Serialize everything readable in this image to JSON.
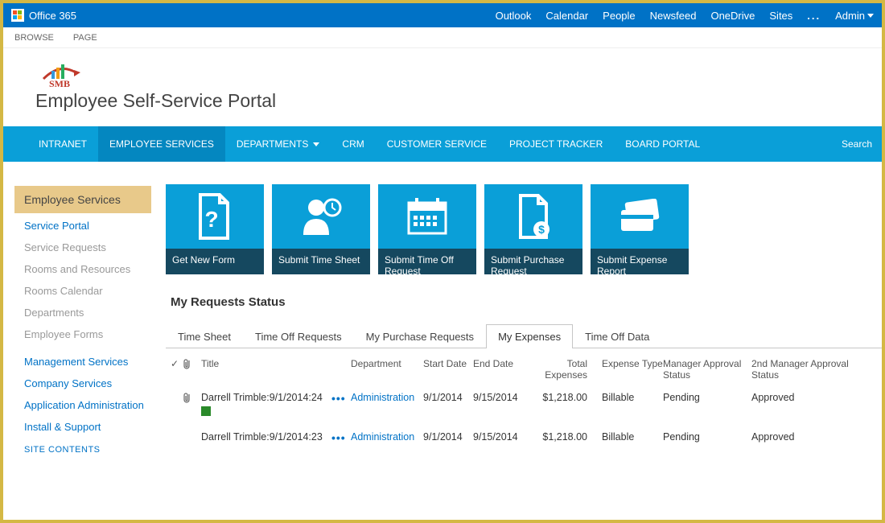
{
  "suite": {
    "brand": "Office 365",
    "links": [
      "Outlook",
      "Calendar",
      "People",
      "Newsfeed",
      "OneDrive",
      "Sites"
    ],
    "more": "...",
    "admin": "Admin"
  },
  "ribbon": {
    "browse": "BROWSE",
    "page": "PAGE"
  },
  "title": {
    "logo_text": "SMB",
    "portal": "Employee Self-Service Portal"
  },
  "topnav": {
    "items": [
      {
        "label": "INTRANET",
        "active": false
      },
      {
        "label": "EMPLOYEE SERVICES",
        "active": true
      },
      {
        "label": "DEPARTMENTS",
        "active": false,
        "dropdown": true
      },
      {
        "label": "CRM",
        "active": false
      },
      {
        "label": "CUSTOMER SERVICE",
        "active": false
      },
      {
        "label": "PROJECT TRACKER",
        "active": false
      },
      {
        "label": "BOARD PORTAL",
        "active": false
      }
    ],
    "search": "Search"
  },
  "sidebar": {
    "header": "Employee Services",
    "items": [
      {
        "label": "Service Portal",
        "muted": false
      },
      {
        "label": "Service Requests",
        "muted": true
      },
      {
        "label": "Rooms and Resources",
        "muted": true
      },
      {
        "label": "Rooms Calendar",
        "muted": true
      },
      {
        "label": "Departments",
        "muted": true
      },
      {
        "label": "Employee Forms",
        "muted": true
      }
    ],
    "groups": [
      "Management Services",
      "Company Services",
      "Application Administration",
      "Install & Support"
    ],
    "site_contents": "SITE CONTENTS"
  },
  "tiles": [
    {
      "label": "Get New Form",
      "icon": "form-question-icon"
    },
    {
      "label": "Submit Time Sheet",
      "icon": "person-clock-icon"
    },
    {
      "label": "Submit Time Off Request",
      "icon": "calendar-icon"
    },
    {
      "label": "Submit Purchase Request",
      "icon": "document-dollar-icon"
    },
    {
      "label": "Submit Expense Report",
      "icon": "credit-card-icon"
    }
  ],
  "requests": {
    "title": "My Requests Status",
    "tabs": [
      "Time Sheet",
      "Time Off Requests",
      "My Purchase Requests",
      "My Expenses",
      "Time Off Data"
    ],
    "active_tab": "My Expenses",
    "columns": {
      "check": "✓",
      "attach": "attach",
      "title": "Title",
      "dept": "Department",
      "start": "Start Date",
      "end": "End Date",
      "total": "Total Expenses",
      "exptype": "Expense Type",
      "mgr1": "Manager Approval Status",
      "mgr2": "2nd Manager Approval Status"
    },
    "rows": [
      {
        "title": "Darrell Trimble:9/1/2014:24",
        "dept": "Administration",
        "start": "9/1/2014",
        "end": "9/15/2014",
        "total": "$1,218.00",
        "exptype": "Billable",
        "mgr1": "Pending",
        "mgr2": "Approved"
      },
      {
        "title": "Darrell Trimble:9/1/2014:23",
        "dept": "Administration",
        "start": "9/1/2014",
        "end": "9/15/2014",
        "total": "$1,218.00",
        "exptype": "Billable",
        "mgr1": "Pending",
        "mgr2": "Approved"
      }
    ]
  }
}
